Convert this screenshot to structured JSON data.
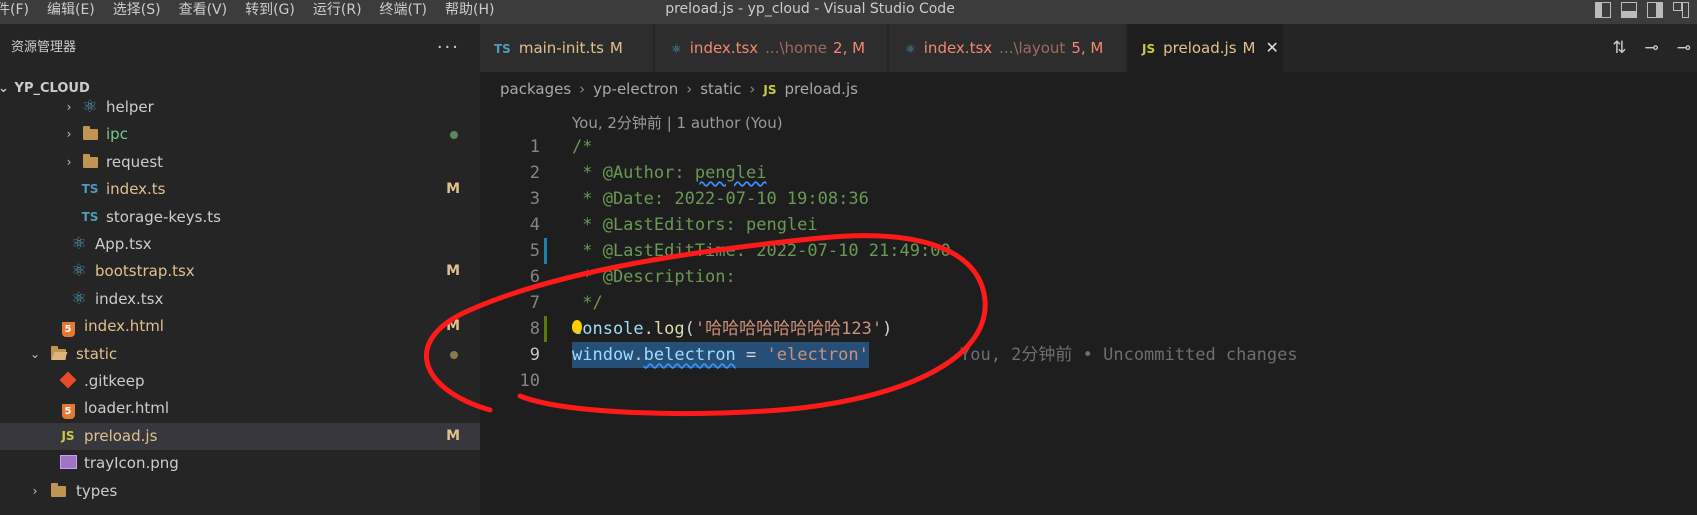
{
  "menu": [
    "件(F)",
    "编辑(E)",
    "选择(S)",
    "查看(V)",
    "转到(G)",
    "运行(R)",
    "终端(T)",
    "帮助(H)"
  ],
  "window_title": "preload.js - yp_cloud - Visual Studio Code",
  "sidebar": {
    "title": "资源管理器",
    "more": "···",
    "project": "YP_CLOUD",
    "items": [
      {
        "label": "helper",
        "type": "folder-react",
        "chevron": "›",
        "color": "#cccccc"
      },
      {
        "label": "ipc",
        "type": "folder",
        "chevron": "›",
        "color": "#73c991",
        "dot": "#5a8a5a"
      },
      {
        "label": "request",
        "type": "folder",
        "chevron": "›",
        "color": "#cccccc"
      },
      {
        "label": "index.ts",
        "type": "ts",
        "color": "#e2c08d",
        "badge": "M"
      },
      {
        "label": "storage-keys.ts",
        "type": "ts",
        "color": "#cccccc"
      },
      {
        "label": "App.tsx",
        "type": "react",
        "color": "#cccccc"
      },
      {
        "label": "bootstrap.tsx",
        "type": "react",
        "color": "#e2c08d",
        "badge": "M"
      },
      {
        "label": "index.tsx",
        "type": "react",
        "color": "#cccccc"
      },
      {
        "label": "index.html",
        "type": "html",
        "color": "#e2c08d",
        "badge": "M"
      },
      {
        "label": "static",
        "type": "folder-open",
        "chevron": "⌄",
        "color": "#e2c08d",
        "dot": "#8a7a4a"
      },
      {
        "label": ".gitkeep",
        "type": "git",
        "color": "#cccccc"
      },
      {
        "label": "loader.html",
        "type": "html",
        "color": "#cccccc"
      },
      {
        "label": "preload.js",
        "type": "js",
        "color": "#e2c08d",
        "badge": "M",
        "selected": true
      },
      {
        "label": "trayIcon.png",
        "type": "image",
        "color": "#cccccc"
      },
      {
        "label": "types",
        "type": "folder",
        "chevron": "›",
        "color": "#cccccc"
      }
    ]
  },
  "tabs": [
    {
      "icon": "TS",
      "name": "main-init.ts",
      "path": "",
      "status": "M"
    },
    {
      "icon": "react",
      "name": "index.tsx",
      "path": "...\\home",
      "status": "2, M"
    },
    {
      "icon": "react",
      "name": "index.tsx",
      "path": "...\\layout",
      "status": "5, M"
    },
    {
      "icon": "JS",
      "name": "preload.js",
      "path": "",
      "status": "M",
      "close": "✕"
    }
  ],
  "breadcrumb": [
    "packages",
    "yp-electron",
    "static",
    "preload.js"
  ],
  "codelens": "You, 2分钟前 | 1 author (You)",
  "code": {
    "line1": "/*",
    "line2_a": " * @Author: ",
    "line2_b": "penglei",
    "line3": " * @Date: 2022-07-10 19:08:36",
    "line4_a": " * @LastEditors: ",
    "line4_b": "penglei",
    "line5": " * @LastEditTime: 2022-07-10 21:49:00",
    "line6": " * @Description:",
    "line7": " */",
    "line8_a": "console",
    "line8_b": ".",
    "line8_c": "log",
    "line8_d": "(",
    "line8_e": "'哈哈哈哈哈哈哈哈123'",
    "line8_f": ")",
    "line9_a": "window",
    "line9_b": ".",
    "line9_c": "belectron",
    "line9_d": " = ",
    "line9_e": "'electron'",
    "blame": "You, 2分钟前 • Uncommitted changes"
  },
  "line_numbers": [
    "1",
    "2",
    "3",
    "4",
    "5",
    "6",
    "7",
    "8",
    "9",
    "10"
  ],
  "colors": {
    "annotation": "#ff1a1a",
    "accent": "#007acc"
  }
}
